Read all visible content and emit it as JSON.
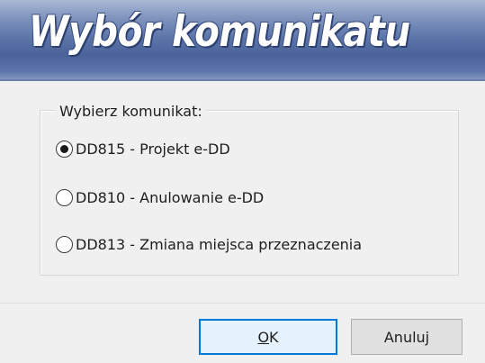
{
  "window": {
    "title": "Wybór komunikatu"
  },
  "group": {
    "label": "Wybierz komunikat:",
    "options": [
      {
        "label": "DD815 - Projekt e-DD",
        "selected": true
      },
      {
        "label": "DD810 - Anulowanie e-DD",
        "selected": false
      },
      {
        "label": "DD813 - Zmiana miejsca przeznaczenia",
        "selected": false
      }
    ]
  },
  "buttons": {
    "ok_mnemonic": "O",
    "ok_rest": "K",
    "cancel_label": "Anuluj"
  },
  "colors": {
    "title_gradient_dark": "#4a639a",
    "title_gradient_light": "#a9b8d4",
    "default_button_border": "#0078d7",
    "default_button_fill": "#e5f1fb",
    "button_fill": "#e1e1e1",
    "dialog_background": "#f0f0f0"
  }
}
